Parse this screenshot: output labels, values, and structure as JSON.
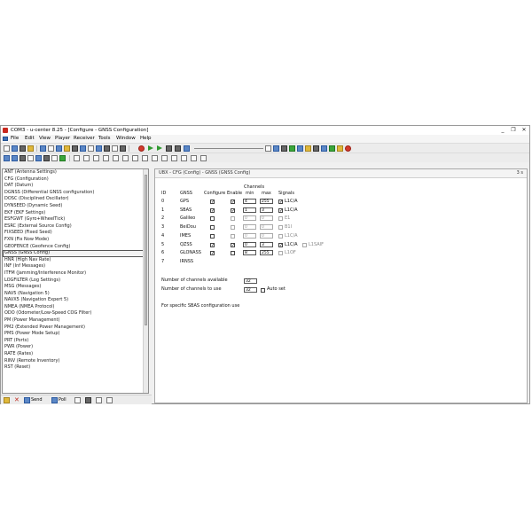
{
  "window": {
    "title": "COM3 - u-center 8.25 - [Configure - GNSS Configuration]",
    "minimize": "_",
    "restore": "❐",
    "close": "✕"
  },
  "menu": [
    "File",
    "Edit",
    "View",
    "Player",
    "Receiver",
    "Tools",
    "Window",
    "Help"
  ],
  "messages": [
    "ANT (Antenna Settings)",
    "CFG (Configuration)",
    "DAT (Datum)",
    "DGNSS (Differential GNSS configuration)",
    "DOSC (Disciplined Oscillator)",
    "DYNSEED (Dynamic Seed)",
    "EKF (EKF Settings)",
    "ESFGWT (Gyro+WheelTick)",
    "ESRC (External Source Config)",
    "FIXSEED (Fixed Seed)",
    "FXN (Fix Now Mode)",
    "GEOFENCE (Geofence Config)",
    "GNSS (GNSS Config)",
    "HNR (High Nav Rate)",
    "INF (Inf Messages)",
    "ITFM (Jamming/Interference Monitor)",
    "LOGFILTER (Log Settings)",
    "MSG (Messages)",
    "NAV5 (Navigation 5)",
    "NAVX5 (Navigation Expert 5)",
    "NMEA (NMEA Protocol)",
    "ODO (Odometer/Low-Speed COG Filter)",
    "PM (Power Management)",
    "PM2 (Extended Power Management)",
    "PMS (Power Mode Setup)",
    "PRT (Ports)",
    "PWR (Power)",
    "RATE (Rates)",
    "RINV (Remote Inventory)",
    "RST (Reset)"
  ],
  "selected_message_index": 12,
  "bottom_bar": {
    "send": "Send",
    "poll": "Poll"
  },
  "config": {
    "header": "UBX - CFG (Config) - GNSS (GNSS Config)",
    "corner": "3 s",
    "col_id": "ID",
    "col_gnss": "GNSS",
    "col_configure": "Configure",
    "col_enable": "Enable",
    "col_channels": "Channels",
    "col_min": "min",
    "col_max": "max",
    "col_signals": "Signals",
    "rows": [
      {
        "id": "0",
        "name": "GPS",
        "configure": true,
        "enable": true,
        "min": "4",
        "max": "255",
        "signal": "L1C/A",
        "signal_on": true,
        "active": true
      },
      {
        "id": "1",
        "name": "SBAS",
        "configure": true,
        "enable": true,
        "min": "1",
        "max": "3",
        "signal": "L1C/A",
        "signal_on": true,
        "active": true
      },
      {
        "id": "2",
        "name": "Galileo",
        "configure": false,
        "enable": false,
        "min": "0",
        "max": "0",
        "signal": "E1",
        "signal_on": false,
        "active": false
      },
      {
        "id": "3",
        "name": "BeiDou",
        "configure": false,
        "enable": false,
        "min": "0",
        "max": "0",
        "signal": "B1I",
        "signal_on": false,
        "active": false
      },
      {
        "id": "4",
        "name": "IMES",
        "configure": false,
        "enable": false,
        "min": "0",
        "max": "0",
        "signal": "L1C/A",
        "signal_on": false,
        "active": false
      },
      {
        "id": "5",
        "name": "QZSS",
        "configure": true,
        "enable": true,
        "min": "0",
        "max": "3",
        "signal": "L1C/A",
        "signal_on": true,
        "signal2": "L1SAIF",
        "active": true
      },
      {
        "id": "6",
        "name": "GLONASS",
        "configure": true,
        "enable": false,
        "min": "8",
        "max": "255",
        "signal": "L1OF",
        "signal_on": false,
        "active": true
      },
      {
        "id": "7",
        "name": "IRNSS",
        "configure": null,
        "enable": null,
        "min": "",
        "max": "",
        "signal": "",
        "signal_on": false,
        "active": false
      }
    ],
    "available_label": "Number of channels available",
    "available_value": "32",
    "to_use_label": "Number of channels to use",
    "to_use_value": "32",
    "auto_set_label": "Auto set",
    "sbas_note": "For specific SBAS configuration use"
  }
}
